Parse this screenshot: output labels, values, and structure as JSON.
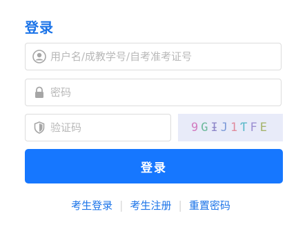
{
  "title": "登录",
  "username": {
    "placeholder": "用户名/成教学号/自考准考证号"
  },
  "password": {
    "placeholder": "密码"
  },
  "captcha_field": {
    "placeholder": "验证码"
  },
  "captcha_image": {
    "text": [
      "9",
      "G",
      "Ɨ",
      "J",
      "1",
      "Ƭ",
      "F",
      "E"
    ]
  },
  "login_button": "登录",
  "links": [
    {
      "label": "考生登录"
    },
    {
      "label": "考生注册"
    },
    {
      "label": "重置密码"
    }
  ],
  "colors": {
    "accent": "#1677ff",
    "title": "#1a73e8",
    "captcha_bg": "#e8ebf9"
  }
}
